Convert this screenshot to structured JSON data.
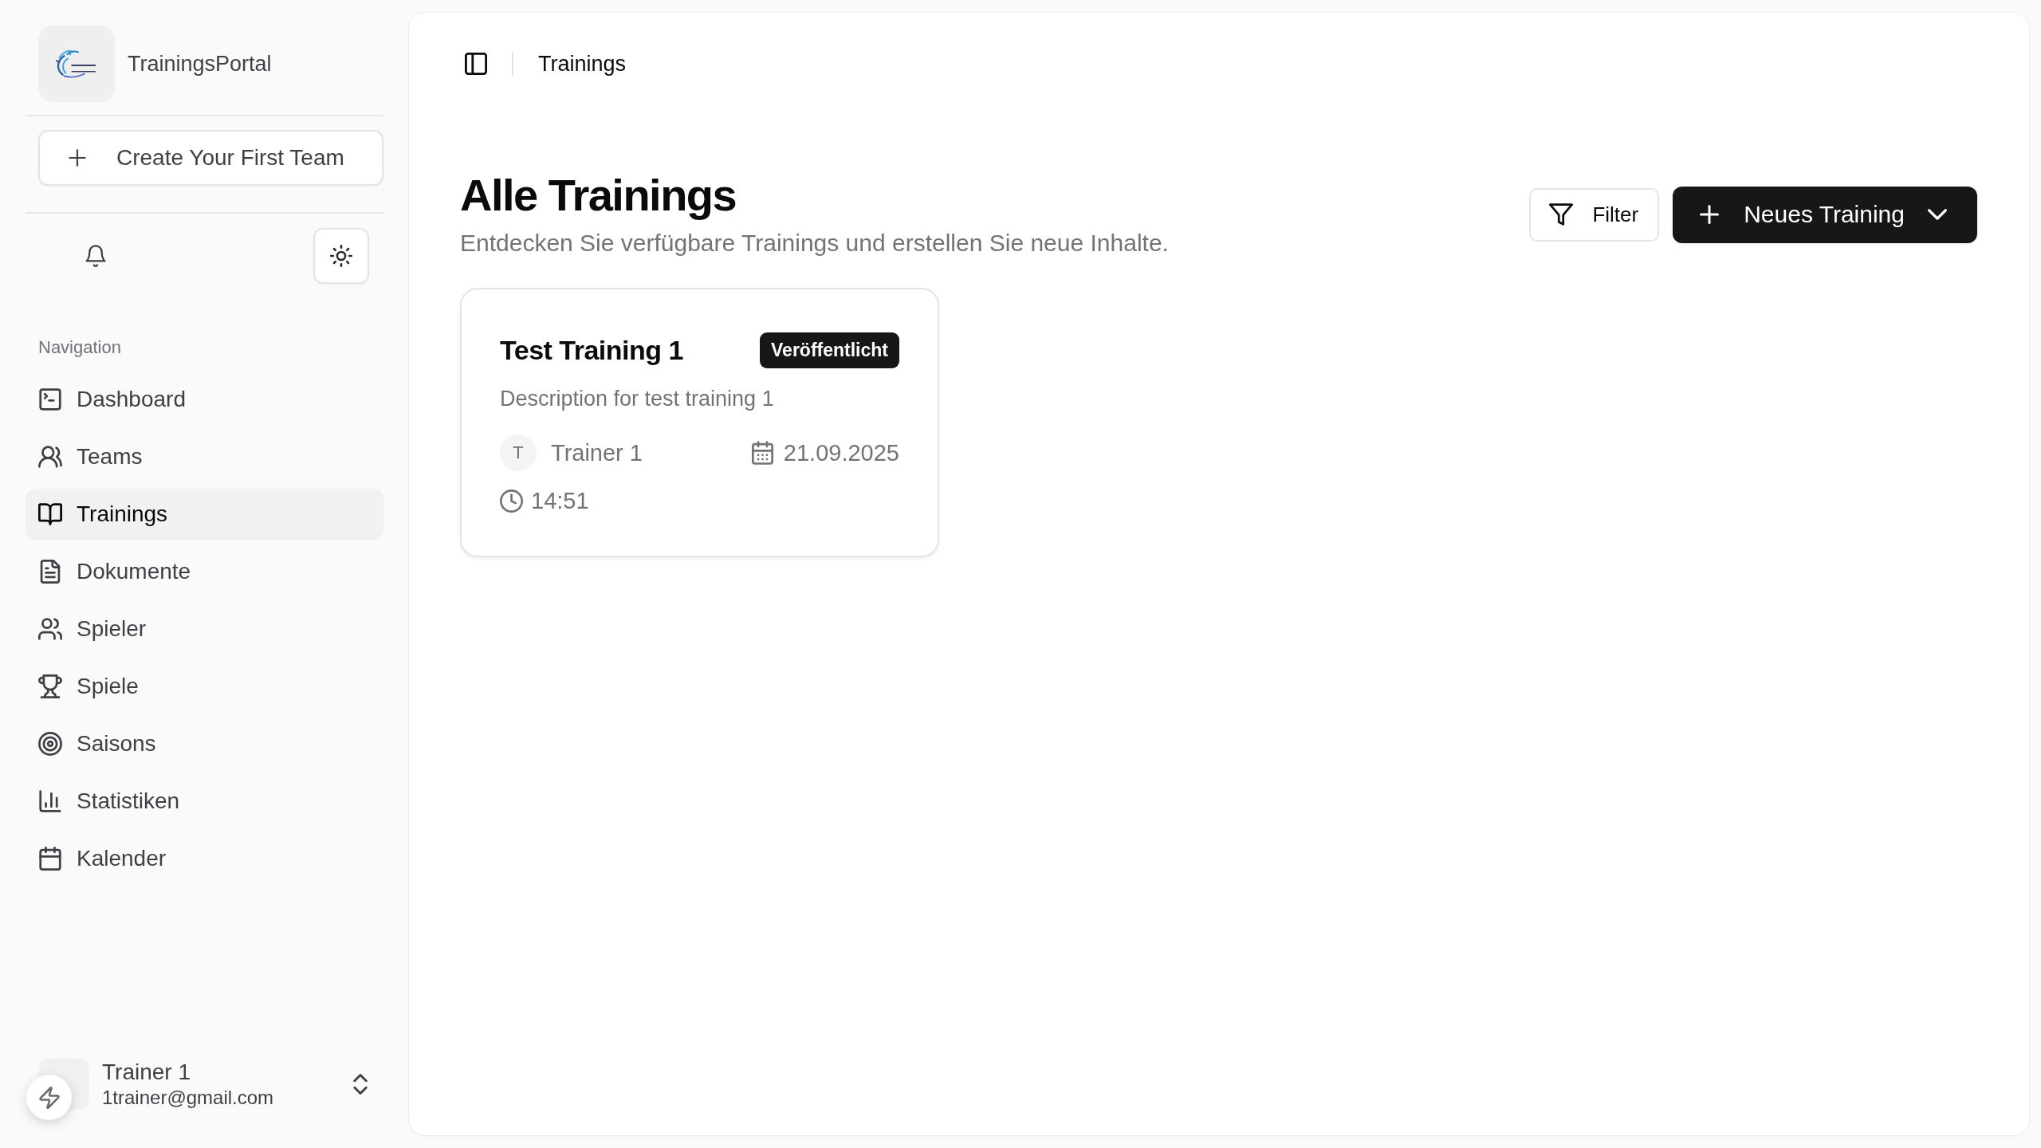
{
  "sidebar": {
    "brand_name": "TrainingsPortal",
    "create_team_button": "Create Your First Team",
    "nav_section_label": "Navigation",
    "nav_items": [
      {
        "label": "Dashboard",
        "selected": false
      },
      {
        "label": "Teams",
        "selected": false
      },
      {
        "label": "Trainings",
        "selected": true
      },
      {
        "label": "Dokumente",
        "selected": false
      },
      {
        "label": "Spieler",
        "selected": false
      },
      {
        "label": "Spiele",
        "selected": false
      },
      {
        "label": "Saisons",
        "selected": false
      },
      {
        "label": "Statistiken",
        "selected": false
      },
      {
        "label": "Kalender",
        "selected": false
      }
    ],
    "user": {
      "name": "Trainer 1",
      "email": "1trainer@gmail.com"
    }
  },
  "header": {
    "breadcrumb": "Trainings"
  },
  "page": {
    "title": "Alle Trainings",
    "subtitle": "Entdecken Sie verfügbare Trainings und erstellen Sie neue Inhalte.",
    "filter_button": "Filter",
    "new_training_button": "Neues Training"
  },
  "trainings": [
    {
      "title": "Test Training 1",
      "status": "Veröffentlicht",
      "description": "Description for test training 1",
      "trainer_initial": "T",
      "trainer": "Trainer 1",
      "date": "21.09.2025",
      "time": "14:51"
    }
  ]
}
